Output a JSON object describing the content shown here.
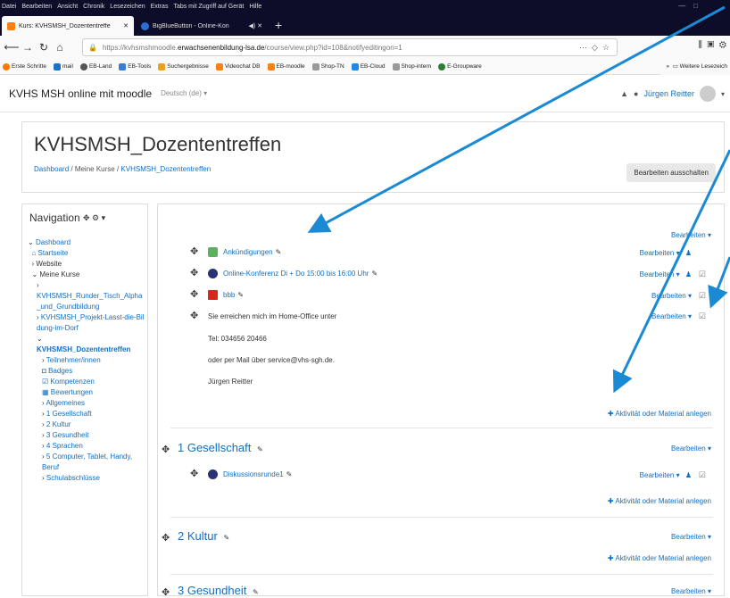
{
  "browser": {
    "menu": [
      "Datei",
      "Bearbeiten",
      "Ansicht",
      "Chronik",
      "Lesezeichen",
      "Extras",
      "Tabs mit Zugriff auf Gerät",
      "Hilfe"
    ],
    "tabs": [
      {
        "title": "Kurs: KVHSMSH_Dozententreffe",
        "active": true
      },
      {
        "title": "BigBlueButton - Online-Kon",
        "active": false
      }
    ],
    "url_prefix": "https://kvhsmshmoodle.",
    "url_domain": "erwachsenenbildung-lsa.de",
    "url_path": "/course/view.php?id=108&notifyeditingon=1",
    "bookmarks": [
      "Erste Schritte",
      "mail",
      "EB-Land",
      "EB-Tools",
      "Suchergebnisse",
      "Videochat DB",
      "EB-moodle",
      "Shop-TN",
      "EB-Cloud",
      "Shop-intern",
      "E-Groupware"
    ],
    "bookmarks_more": "Weitere Lesezeich"
  },
  "site": {
    "name": "KVHS MSH online mit moodle",
    "language": "Deutsch (de) ▾",
    "user": "Jürgen Reitter"
  },
  "course": {
    "title": "KVHSMSH_Dozententreffen",
    "breadcrumb": [
      "Dashboard",
      "Meine Kurse",
      "KVHSMSH_Dozententreffen"
    ],
    "edit_button": "Bearbeiten ausschalten"
  },
  "navigation": {
    "title": "Navigation",
    "items": [
      "Dashboard",
      "Startseite",
      "Website",
      "Meine Kurse",
      "KVHSMSH_Runder_Tisch_Alpha_und_Grundbildung",
      "KVHSMSH_Projekt-Lasst-die-Bildung-im-Dorf",
      "KVHSMSH_Dozententreffen",
      "Teilnehmer/innen",
      "Badges",
      "Kompetenzen",
      "Bewertungen",
      "Allgemeines",
      "1 Gesellschaft",
      "2 Kultur",
      "3 Gesundheit",
      "4 Sprachen",
      "5 Computer, Tablet, Handy, Beruf",
      "Schulabschlüsse"
    ]
  },
  "section0": {
    "edit": "Bearbeiten",
    "activities": [
      {
        "name": "Ankündigungen",
        "edit": "Bearbeiten",
        "icon": "forum-icon"
      },
      {
        "name": "Online-Konferenz Di + Do 15:00 bis 16:00 Uhr",
        "edit": "Bearbeiten",
        "icon": "bigbluebutton-icon"
      },
      {
        "name": "bbb",
        "edit": "Bearbeiten",
        "icon": "pdf-icon"
      }
    ],
    "label_lines": [
      "Sie erreichen mich im Home-Office unter",
      "Tel: 034656 20466",
      "oder per Mail über service@vhs-sgh.de.",
      "Jürgen Reitter"
    ],
    "label_edit": "Bearbeiten",
    "add": "Aktivität oder Material anlegen"
  },
  "sections": [
    {
      "title": "1 Gesellschaft",
      "edit": "Bearbeiten",
      "activity": "Diskussionsrunde1",
      "activity_edit": "Bearbeiten",
      "add": "Aktivität oder Material anlegen"
    },
    {
      "title": "2 Kultur",
      "edit": "Bearbeiten",
      "add": "Aktivität oder Material anlegen"
    },
    {
      "title": "3 Gesundheit",
      "edit": "Bearbeiten"
    }
  ],
  "colors": {
    "link": "#0f6fc5",
    "arrow": "#1a8ad4"
  }
}
